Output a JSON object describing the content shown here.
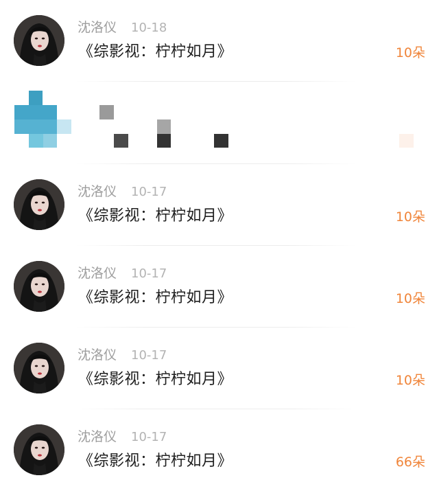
{
  "messages": [
    {
      "name": "沈洛仪",
      "date": "10-18",
      "text": "《综影视：柠柠如月》",
      "count": "10朵"
    },
    {
      "name": "沈洛仪",
      "date": "10-17",
      "text": "《综影视：柠柠如月》",
      "count": "10朵"
    },
    {
      "name": "沈洛仪",
      "date": "10-17",
      "text": "《综影视：柠柠如月》",
      "count": "10朵"
    },
    {
      "name": "沈洛仪",
      "date": "10-17",
      "text": "《综影视：柠柠如月》",
      "count": "10朵"
    },
    {
      "name": "沈洛仪",
      "date": "10-17",
      "text": "《综影视：柠柠如月》",
      "count": "66朵"
    }
  ],
  "colors": {
    "accent": "#f0853a",
    "name_gray": "#9e9e9e",
    "text_dark": "#1f1f1f"
  }
}
